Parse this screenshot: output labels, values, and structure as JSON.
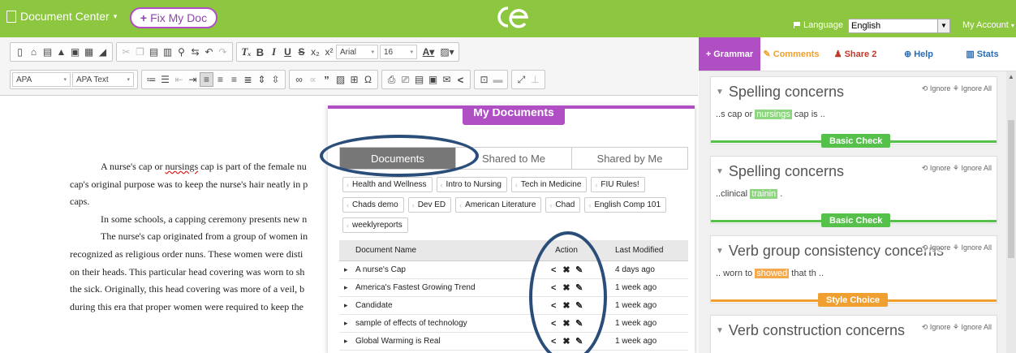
{
  "header": {
    "document_center": "Document Center",
    "fix_button": "Fix My Doc",
    "logo": "ce",
    "language_label": "Language",
    "language_value": "English",
    "account": "My Account"
  },
  "toolbar": {
    "font": "Arial",
    "size": "16",
    "style_apa": "APA",
    "style_apa_text": "APA Text"
  },
  "document": {
    "lines": [
      "A nurse's cap or nursings cap is part of the female nu",
      "cap's original purpose was to keep the nurse's hair neatly in p",
      "caps.",
      "In some schools, a capping ceremony presents new n",
      "The nurse's cap originated from a group of women in",
      "recognized as religious order nuns. These women were disti",
      "on their heads. This particular head covering was worn to sh",
      "the sick. Originally, this head covering was more of a veil, b",
      "during this era that proper women were required to keep the"
    ]
  },
  "modal": {
    "title": "My Documents",
    "tabs": [
      "Documents",
      "Shared to Me",
      "Shared by Me"
    ],
    "folders": [
      "Health and Wellness",
      "Intro to Nursing",
      "Tech in Medicine",
      "FIU Rules!",
      "Chads demo",
      "Dev ED",
      "American Literature",
      "Chad",
      "English Comp 101",
      "weeklyreports"
    ],
    "columns": {
      "name": "Document Name",
      "action": "Action",
      "modified": "Last Modified"
    },
    "rows": [
      {
        "name": "A nurse's Cap",
        "modified": "4 days ago"
      },
      {
        "name": "America's Fastest Growing Trend",
        "modified": "1 week ago"
      },
      {
        "name": "Candidate",
        "modified": "1 week ago"
      },
      {
        "name": "sample of effects of technology",
        "modified": "1 week ago"
      },
      {
        "name": "Global Warming is Real",
        "modified": "1 week ago"
      }
    ]
  },
  "right_panel": {
    "tabs": {
      "grammar": "Grammar",
      "comments": "Comments",
      "share": "Share 2",
      "help": "Help",
      "stats": "Stats"
    },
    "ignore": "Ignore",
    "ignore_all": "Ignore All",
    "cards": [
      {
        "title": "Spelling concerns",
        "ctx_before": "..s cap or ",
        "ctx_hl": "nursings",
        "ctx_after": " cap is ..",
        "badge": "Basic Check"
      },
      {
        "title": "Spelling concerns",
        "ctx_before": "..clinical ",
        "ctx_hl": "trainin",
        "ctx_after": " .",
        "badge": "Basic Check"
      },
      {
        "title": "Verb group consistency concerns",
        "ctx_before": ".. worn to ",
        "ctx_hl": "showed",
        "ctx_after": " that th ..",
        "badge": "Style Choice"
      },
      {
        "title": "Verb construction concerns"
      }
    ]
  },
  "colors": {
    "brand_green": "#8dc63f",
    "accent_purple": "#b04fc4",
    "highlight_navy": "#2a4d7a"
  }
}
